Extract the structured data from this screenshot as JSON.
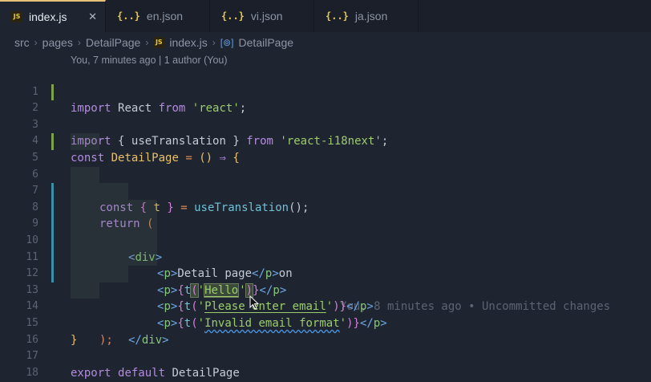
{
  "tabs": [
    {
      "label": "index.js",
      "icon": "JS",
      "active": true,
      "close": "✕"
    },
    {
      "label": "en.json",
      "icon": "{..}"
    },
    {
      "label": "vi.json",
      "icon": "{..}"
    },
    {
      "label": "ja.json",
      "icon": "{..}"
    }
  ],
  "breadcrumb": {
    "items": [
      "src",
      "pages",
      "DetailPage",
      "index.js",
      "DetailPage"
    ],
    "js_icon": "JS",
    "symbol_icon": "[⊚]"
  },
  "codelens": "You, 7 minutes ago | 1 author (You)",
  "blame": "You, 8 minutes ago • Uncommitted changes",
  "line_numbers": [
    "1",
    "2",
    "3",
    "4",
    "5",
    "6",
    "7",
    "8",
    "9",
    "10",
    "11",
    "12",
    "13",
    "14",
    "15",
    "16",
    "17",
    "18"
  ],
  "code": {
    "l1": {
      "k1": "import",
      "a": "React",
      "k2": "from",
      "s": "'react'",
      "e": ";"
    },
    "l2": {
      "k1": "import",
      "b1": "{",
      "a": "useTranslation",
      "b2": "}",
      "k2": "from",
      "s": "'react-i18next'",
      "e": ";"
    },
    "l4": {
      "k": "const",
      "n": "DetailPage",
      "eq": "=",
      "p": "()",
      "arrow": "⇒",
      "b": "{"
    },
    "l5": {
      "k": "const",
      "b1": "{",
      "t": "t",
      "b2": "}",
      "eq": "=",
      "f": "useTranslation",
      "p": "();"
    },
    "l7": {
      "k": "return",
      "p": "("
    },
    "l8": {
      "lt": "<",
      "tag": "div",
      "gt": ">"
    },
    "l9": {
      "open": "<",
      "tag": "p",
      "gt": ">",
      "text": "Detail page",
      "close": "</",
      "tag2": "p",
      "gt2": ">",
      "tail": "on"
    },
    "l10": {
      "open": "<",
      "tag": "p",
      "gt": ">",
      "b1": "{",
      "fn": "t",
      "pa": "(",
      "q1": "'",
      "str": "Hello",
      "q2": "'",
      "pb": ")",
      "b2": "}",
      "close": "</",
      "tag2": "p",
      "gt2": ">"
    },
    "l11": {
      "open": "<",
      "tag": "p",
      "gt": ">",
      "b1": "{",
      "fn": "t",
      "pa": "(",
      "q1": "'",
      "str": "Please enter email",
      "q2": "'",
      "pb": ")",
      "b2": "}",
      "close": "</",
      "tag2": "p",
      "gt2": ">"
    },
    "l12": {
      "open": "<",
      "tag": "p",
      "gt": ">",
      "b1": "{",
      "fn": "t",
      "pa": "(",
      "q1": "'",
      "str": "Invalid email format",
      "q2": "'",
      "pb": ")",
      "b2": "}",
      "close": "</",
      "tag2": "p",
      "gt2": ">"
    },
    "l13": {
      "close": "</",
      "tag": "div",
      "gt": ">"
    },
    "l14": {
      "p": ");"
    },
    "l15": {
      "b": "}"
    },
    "l17": {
      "k1": "export",
      "k2": "default",
      "n": "DetailPage"
    }
  },
  "colors": {
    "background": "#1e2430",
    "tab_active_border": "#e6c07b",
    "keyword": "#b38be0",
    "string": "#9ccd6c",
    "function": "#70c0d6",
    "variable": "#e8c06a",
    "tag": "#6ea9e6"
  }
}
